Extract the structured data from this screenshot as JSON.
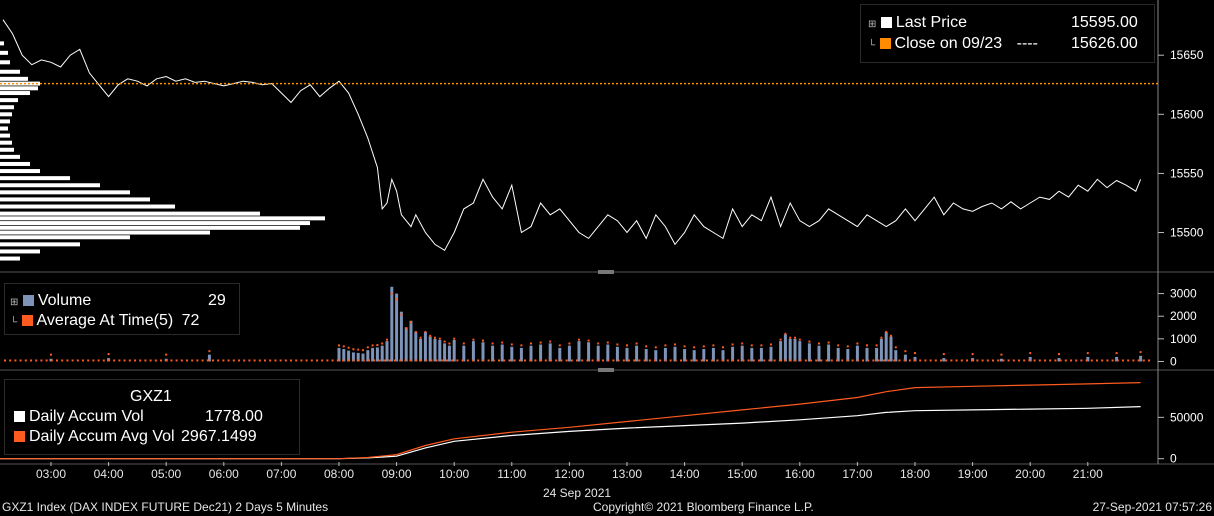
{
  "colors": {
    "price": "#ffffff",
    "close": "#ff8c00",
    "volume": "#7d93b8",
    "avg": "#ff5a1f",
    "accum": "#ffffff",
    "accum_avg": "#ff5a1f",
    "grid": "#3a3a3a",
    "axis": "#bfbfbf"
  },
  "legend_price": {
    "last_label": "Last Price",
    "last_value": "15595.00",
    "close_label": "Close on 09/23",
    "close_dash": "----",
    "close_value": "15626.00"
  },
  "legend_volume": {
    "vol_label": "Volume",
    "vol_value": "29",
    "avg_label": "Average At Time(5)",
    "avg_value": "72"
  },
  "legend_accum": {
    "title": "GXZ1",
    "vol_label": "Daily Accum Vol",
    "vol_value": "1778.00",
    "avg_label": "Daily Accum Avg Vol",
    "avg_value": "2967.1499"
  },
  "footer": {
    "left": "GXZ1 Index (DAX INDEX FUTURE  Dec21) 2 Days 5 Minutes",
    "center": "Copyright© 2021 Bloomberg Finance L.P.",
    "right": "27-Sep-2021 07:57:26"
  },
  "chart_data": [
    {
      "type": "line",
      "series": [
        {
          "name": "Last Price",
          "x": [
            "02:10",
            "02:20",
            "02:30",
            "02:40",
            "02:50",
            "03:00",
            "03:10",
            "03:20",
            "03:30",
            "03:40",
            "03:50",
            "04:00",
            "04:10",
            "04:20",
            "04:30",
            "04:40",
            "04:50",
            "05:00",
            "05:10",
            "05:20",
            "05:30",
            "05:40",
            "05:50",
            "06:00",
            "06:10",
            "06:20",
            "06:30",
            "06:40",
            "06:50",
            "07:00",
            "07:10",
            "07:20",
            "07:30",
            "07:40",
            "07:50",
            "08:00",
            "08:10",
            "08:20",
            "08:30",
            "08:40",
            "08:45",
            "08:50",
            "08:55",
            "09:00",
            "09:05",
            "09:10",
            "09:15",
            "09:20",
            "09:30",
            "09:40",
            "09:50",
            "10:00",
            "10:10",
            "10:20",
            "10:30",
            "10:40",
            "10:50",
            "11:00",
            "11:10",
            "11:20",
            "11:30",
            "11:40",
            "11:50",
            "12:00",
            "12:10",
            "12:20",
            "12:30",
            "12:40",
            "12:50",
            "13:00",
            "13:10",
            "13:20",
            "13:30",
            "13:40",
            "13:50",
            "14:00",
            "14:10",
            "14:20",
            "14:30",
            "14:40",
            "14:50",
            "15:00",
            "15:10",
            "15:20",
            "15:30",
            "15:40",
            "15:50",
            "16:00",
            "16:10",
            "16:20",
            "16:30",
            "16:40",
            "16:50",
            "17:00",
            "17:10",
            "17:20",
            "17:30",
            "17:40",
            "17:50",
            "18:00",
            "18:10",
            "18:20",
            "18:30",
            "18:40",
            "18:50",
            "19:00",
            "19:10",
            "19:20",
            "19:30",
            "19:40",
            "19:50",
            "20:00",
            "20:10",
            "20:20",
            "20:30",
            "20:40",
            "20:50",
            "21:00",
            "21:10",
            "21:20",
            "21:30",
            "21:40",
            "21:50",
            "21:55"
          ],
          "values": [
            15680,
            15668,
            15650,
            15642,
            15646,
            15644,
            15640,
            15650,
            15655,
            15635,
            15625,
            15615,
            15625,
            15630,
            15628,
            15624,
            15630,
            15632,
            15628,
            15630,
            15627,
            15628,
            15626,
            15624,
            15626,
            15628,
            15627,
            15625,
            15626,
            15618,
            15610,
            15620,
            15625,
            15615,
            15622,
            15628,
            15618,
            15600,
            15580,
            15555,
            15520,
            15525,
            15545,
            15535,
            15515,
            15510,
            15505,
            15515,
            15500,
            15490,
            15485,
            15500,
            15520,
            15525,
            15545,
            15530,
            15520,
            15540,
            15500,
            15505,
            15525,
            15515,
            15520,
            15510,
            15500,
            15495,
            15505,
            15515,
            15510,
            15500,
            15510,
            15495,
            15515,
            15505,
            15490,
            15500,
            15515,
            15505,
            15500,
            15495,
            15520,
            15505,
            15515,
            15510,
            15530,
            15505,
            15525,
            15510,
            15505,
            15510,
            15520,
            15515,
            15510,
            15505,
            15515,
            15510,
            15505,
            15510,
            15520,
            15510,
            15520,
            15530,
            15515,
            15525,
            15520,
            15518,
            15522,
            15525,
            15520,
            15526,
            15520,
            15525,
            15530,
            15528,
            15535,
            15530,
            15540,
            15535,
            15545,
            15538,
            15544,
            15540,
            15535,
            15545
          ]
        },
        {
          "name": "Close on 09/23",
          "y": 15626
        }
      ],
      "yticks": [
        15650,
        15600,
        15550,
        15500
      ],
      "ylim": [
        15470,
        15695
      ],
      "volume_profile": [
        {
          "price": 15660,
          "w": 4
        },
        {
          "price": 15652,
          "w": 8
        },
        {
          "price": 15644,
          "w": 10
        },
        {
          "price": 15636,
          "w": 20
        },
        {
          "price": 15630,
          "w": 28
        },
        {
          "price": 15626,
          "w": 40
        },
        {
          "price": 15622,
          "w": 38
        },
        {
          "price": 15618,
          "w": 30
        },
        {
          "price": 15612,
          "w": 18
        },
        {
          "price": 15606,
          "w": 14
        },
        {
          "price": 15600,
          "w": 12
        },
        {
          "price": 15594,
          "w": 10
        },
        {
          "price": 15588,
          "w": 8
        },
        {
          "price": 15582,
          "w": 10
        },
        {
          "price": 15576,
          "w": 12
        },
        {
          "price": 15570,
          "w": 14
        },
        {
          "price": 15564,
          "w": 20
        },
        {
          "price": 15558,
          "w": 30
        },
        {
          "price": 15552,
          "w": 40
        },
        {
          "price": 15546,
          "w": 70
        },
        {
          "price": 15540,
          "w": 100
        },
        {
          "price": 15534,
          "w": 130
        },
        {
          "price": 15528,
          "w": 150
        },
        {
          "price": 15522,
          "w": 175
        },
        {
          "price": 15516,
          "w": 260
        },
        {
          "price": 15512,
          "w": 325
        },
        {
          "price": 15508,
          "w": 310
        },
        {
          "price": 15504,
          "w": 300
        },
        {
          "price": 15500,
          "w": 210
        },
        {
          "price": 15496,
          "w": 130
        },
        {
          "price": 15490,
          "w": 80
        },
        {
          "price": 15484,
          "w": 40
        },
        {
          "price": 15478,
          "w": 20
        }
      ]
    },
    {
      "type": "bar",
      "series": [
        {
          "name": "Volume",
          "x": [
            "02:05",
            "03:00",
            "04:00",
            "05:00",
            "05:45",
            "08:00",
            "08:05",
            "08:10",
            "08:15",
            "08:20",
            "08:25",
            "08:30",
            "08:35",
            "08:40",
            "08:45",
            "08:50",
            "08:55",
            "09:00",
            "09:05",
            "09:10",
            "09:15",
            "09:20",
            "09:25",
            "09:30",
            "09:35",
            "09:40",
            "09:45",
            "09:50",
            "09:55",
            "10:00",
            "10:10",
            "10:20",
            "10:30",
            "10:40",
            "10:50",
            "11:00",
            "11:10",
            "11:20",
            "11:30",
            "11:40",
            "11:50",
            "12:00",
            "12:10",
            "12:20",
            "12:30",
            "12:40",
            "12:50",
            "13:00",
            "13:10",
            "13:20",
            "13:30",
            "13:40",
            "13:50",
            "14:00",
            "14:10",
            "14:20",
            "14:30",
            "14:40",
            "14:50",
            "15:00",
            "15:10",
            "15:20",
            "15:30",
            "15:40",
            "15:45",
            "15:50",
            "15:55",
            "16:00",
            "16:10",
            "16:20",
            "16:30",
            "16:40",
            "16:50",
            "17:00",
            "17:10",
            "17:20",
            "17:25",
            "17:30",
            "17:35",
            "17:40",
            "17:50",
            "18:00",
            "18:30",
            "19:00",
            "19:30",
            "20:00",
            "20:30",
            "21:00",
            "21:30",
            "21:55"
          ],
          "values": [
            500,
            120,
            150,
            120,
            300,
            600,
            550,
            480,
            400,
            380,
            350,
            500,
            600,
            620,
            700,
            900,
            3300,
            3000,
            2200,
            1500,
            1800,
            1300,
            1000,
            1300,
            1100,
            1000,
            950,
            800,
            700,
            950,
            700,
            900,
            850,
            700,
            750,
            650,
            600,
            700,
            750,
            800,
            600,
            700,
            900,
            850,
            700,
            750,
            650,
            600,
            700,
            550,
            500,
            600,
            650,
            550,
            500,
            550,
            600,
            500,
            650,
            700,
            600,
            600,
            650,
            900,
            1200,
            1000,
            1000,
            900,
            800,
            700,
            750,
            600,
            550,
            700,
            600,
            600,
            1000,
            1300,
            1100,
            500,
            300,
            200,
            150,
            150,
            120,
            200,
            150,
            200,
            200,
            250
          ]
        },
        {
          "name": "Average At Time(5)"
        }
      ],
      "yticks": [
        3000,
        2000,
        1000,
        0
      ],
      "ylim": [
        -200,
        3600
      ]
    },
    {
      "type": "line",
      "series": [
        {
          "name": "Daily Accum Vol",
          "x": [
            "02:00",
            "08:00",
            "08:30",
            "09:00",
            "09:30",
            "10:00",
            "11:00",
            "12:00",
            "13:00",
            "14:00",
            "15:00",
            "16:00",
            "17:00",
            "17:30",
            "18:00",
            "19:00",
            "20:00",
            "21:00",
            "21:55"
          ],
          "values": [
            0,
            0,
            1000,
            3000,
            13000,
            21000,
            28000,
            33000,
            37000,
            40000,
            43000,
            47000,
            52000,
            56000,
            58000,
            59000,
            60000,
            61000,
            63000
          ]
        },
        {
          "name": "Daily Accum Avg Vol",
          "x": [
            "02:00",
            "08:00",
            "08:30",
            "09:00",
            "09:30",
            "10:00",
            "11:00",
            "12:00",
            "13:00",
            "14:00",
            "15:00",
            "16:00",
            "17:00",
            "17:30",
            "18:00",
            "19:00",
            "20:00",
            "21:00",
            "21:55"
          ],
          "values": [
            0,
            0,
            1500,
            5000,
            16000,
            24000,
            32000,
            38000,
            45000,
            52000,
            59000,
            66000,
            74000,
            81000,
            86000,
            87500,
            89000,
            90500,
            92000
          ]
        }
      ],
      "yticks": [
        50000,
        0
      ],
      "ylim": [
        -4000,
        100000
      ]
    }
  ],
  "x_axis": {
    "ticks": [
      "03:00",
      "04:00",
      "05:00",
      "06:00",
      "07:00",
      "08:00",
      "09:00",
      "10:00",
      "11:00",
      "12:00",
      "13:00",
      "14:00",
      "15:00",
      "16:00",
      "17:00",
      "18:00",
      "19:00",
      "20:00",
      "21:00"
    ],
    "date_label": "24 Sep 2021"
  }
}
